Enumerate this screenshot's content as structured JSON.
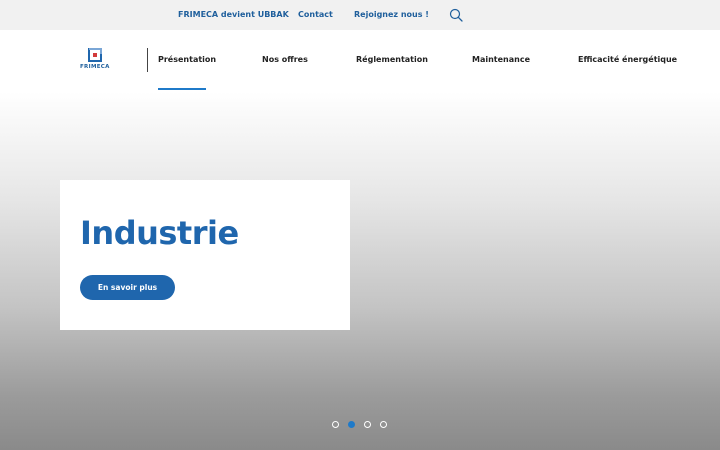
{
  "topbar": {
    "links": [
      "FRIMECA devient UBBAK",
      "Contact",
      "Rejoignez nous !"
    ],
    "search_icon": "search-icon"
  },
  "header": {
    "logo_text": "FRIMECA",
    "nav": [
      "Présentation",
      "Nos offres",
      "Réglementation",
      "Maintenance",
      "Efficacité énergétique"
    ],
    "active_nav": "Présentation"
  },
  "hero": {
    "title": "Industrie",
    "cta_label": "En savoir plus",
    "slides_total": 4,
    "active_slide": 2
  },
  "colors": {
    "brand_blue": "#1f66ad",
    "accent_blue": "#1f7ac9",
    "logo_red": "#d33a3a"
  }
}
